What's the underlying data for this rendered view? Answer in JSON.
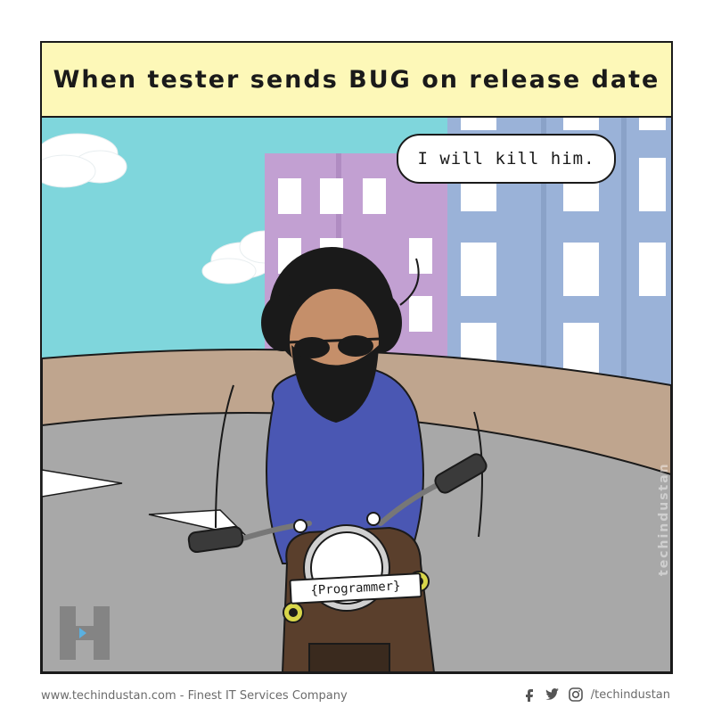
{
  "caption": "When tester sends BUG on release date",
  "speech": "I will kill him.",
  "plate": "{Programmer}",
  "watermark": "techindustan",
  "footer": {
    "site": "www.techindustan.com - Finest IT Services Company",
    "handle": "/techindustan",
    "icons": [
      "facebook-icon",
      "twitter-icon",
      "instagram-icon"
    ]
  },
  "colors": {
    "sky": "#7fd6dc",
    "caption_bg": "#fdf8b8",
    "building_purple": "#c2a0d2",
    "building_blue": "#9ab2d8",
    "wall": "#bfa58e",
    "road": "#a8a8a8",
    "shirt": "#4a57b3",
    "bike": "#5a3f2c"
  }
}
